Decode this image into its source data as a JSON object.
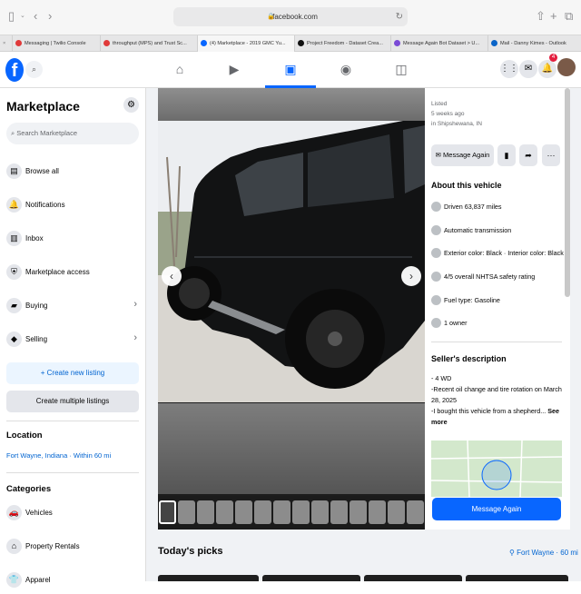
{
  "browser": {
    "url": "facebook.com",
    "tabs": [
      {
        "label": "Messaging | Twilio Console",
        "color": "#e03a3a"
      },
      {
        "label": "throughput (MPS) and Trust Sc...",
        "color": "#e03a3a"
      },
      {
        "label": "(4) Marketplace - 2019 GMC Yu...",
        "color": "#0866ff"
      },
      {
        "label": "Project Freedom - Dataset Crea...",
        "color": "#111111"
      },
      {
        "label": "Message Again Bot Dataset > U...",
        "color": "#7b4bd6"
      },
      {
        "label": "Mail - Danny Kimes - Outlook",
        "color": "#0a64c8"
      }
    ]
  },
  "nav": {
    "notif_count": "4"
  },
  "sidebar": {
    "title": "Marketplace",
    "search_placeholder": "Search Marketplace",
    "items": [
      {
        "label": "Browse all",
        "icon": "store-icon"
      },
      {
        "label": "Notifications",
        "icon": "bell-icon"
      },
      {
        "label": "Inbox",
        "icon": "inbox-icon"
      },
      {
        "label": "Marketplace access",
        "icon": "shield-icon"
      },
      {
        "label": "Buying",
        "icon": "bag-icon"
      },
      {
        "label": "Selling",
        "icon": "tag-icon"
      }
    ],
    "create_listing": "+ Create new listing",
    "create_multiple": "Create multiple listings",
    "location_heading": "Location",
    "location_value": "Fort Wayne, Indiana · Within 60 mi",
    "categories_heading": "Categories",
    "categories": [
      {
        "label": "Vehicles",
        "icon": "car-icon"
      },
      {
        "label": "Property Rentals",
        "icon": "house-icon"
      },
      {
        "label": "Apparel",
        "icon": "shirt-icon"
      }
    ]
  },
  "listing": {
    "listed_label": "Listed",
    "listed_time": "5 weeks ago",
    "listed_location": "in Shipshewana, IN",
    "message_button": "Message Again",
    "about_heading": "About this vehicle",
    "features": [
      "Driven 63,837 miles",
      "Automatic transmission",
      "Exterior color: Black · Interior color: Black",
      "4/5 overall NHTSA safety rating",
      "Fuel type: Gasoline",
      "1 owner"
    ],
    "seller_heading": "Seller's description",
    "desc_lines": [
      "- 4 WD",
      "-Recent oil change and tire rotation on March 28, 2025",
      "-I bought this vehicle from a shepherd..."
    ],
    "see_more": "See more",
    "bottom_button": "Message Again"
  },
  "main": {
    "picks_heading": "Today's picks",
    "picks_location": "Fort Wayne · 60 mi"
  }
}
